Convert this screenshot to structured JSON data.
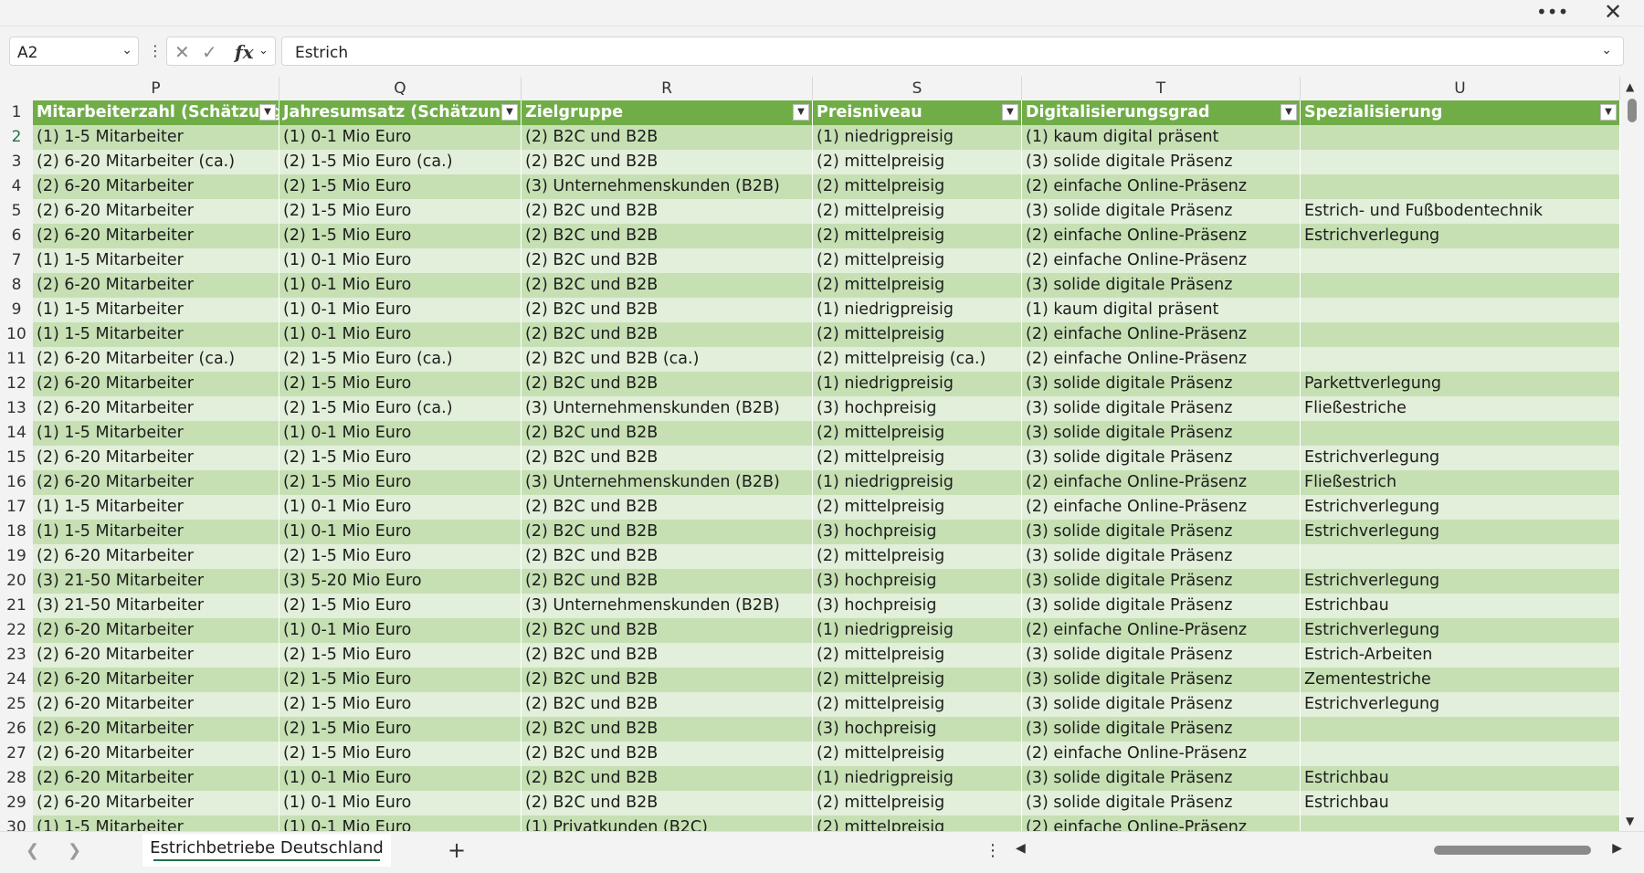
{
  "window": {
    "more_label": "•••",
    "close_label": "✕"
  },
  "formula_bar": {
    "name_box": "A2",
    "cancel_icon": "close-icon",
    "enter_icon": "check-icon",
    "fx_label": "fx",
    "value": "Estrich"
  },
  "columns": [
    "P",
    "Q",
    "R",
    "S",
    "T",
    "U"
  ],
  "row_numbers": [
    "1",
    "2",
    "3",
    "4",
    "5",
    "6",
    "7",
    "8",
    "9",
    "10",
    "11",
    "12",
    "13",
    "14",
    "15",
    "16",
    "17",
    "18",
    "19",
    "20",
    "21",
    "22",
    "23",
    "24",
    "25",
    "26",
    "27",
    "28",
    "29",
    "30"
  ],
  "header": [
    "Mitarbeiterzahl (Schätzung)",
    "Jahresumsatz (Schätzung)",
    "Zielgruppe",
    "Preisniveau",
    "Digitalisierungsgrad",
    "Spezialisierung"
  ],
  "rows": [
    [
      "(1) 1-5 Mitarbeiter",
      "(1) 0-1 Mio Euro",
      "(2) B2C und B2B",
      "(1) niedrigpreisig",
      "(1) kaum digital präsent",
      ""
    ],
    [
      "(2) 6-20 Mitarbeiter (ca.)",
      "(2) 1-5 Mio Euro (ca.)",
      "(2) B2C und B2B",
      "(2) mittelpreisig",
      "(3) solide digitale Präsenz",
      ""
    ],
    [
      "(2) 6-20 Mitarbeiter",
      "(2) 1-5 Mio Euro",
      "(3) Unternehmenskunden (B2B)",
      "(2) mittelpreisig",
      "(2) einfache Online-Präsenz",
      ""
    ],
    [
      "(2) 6-20 Mitarbeiter",
      "(2) 1-5 Mio Euro",
      "(2) B2C und B2B",
      "(2) mittelpreisig",
      "(3) solide digitale Präsenz",
      "Estrich- und Fußbodentechnik"
    ],
    [
      "(2) 6-20 Mitarbeiter",
      "(2) 1-5 Mio Euro",
      "(2) B2C und B2B",
      "(2) mittelpreisig",
      "(2) einfache Online-Präsenz",
      "Estrichverlegung"
    ],
    [
      "(1) 1-5 Mitarbeiter",
      "(1) 0-1 Mio Euro",
      "(2) B2C und B2B",
      "(2) mittelpreisig",
      "(2) einfache Online-Präsenz",
      ""
    ],
    [
      "(2) 6-20 Mitarbeiter",
      "(1) 0-1 Mio Euro",
      "(2) B2C und B2B",
      "(2) mittelpreisig",
      "(3) solide digitale Präsenz",
      ""
    ],
    [
      "(1) 1-5 Mitarbeiter",
      "(1) 0-1 Mio Euro",
      "(2) B2C und B2B",
      "(1) niedrigpreisig",
      "(1) kaum digital präsent",
      ""
    ],
    [
      "(1) 1-5 Mitarbeiter",
      "(1) 0-1 Mio Euro",
      "(2) B2C und B2B",
      "(2) mittelpreisig",
      "(2) einfache Online-Präsenz",
      ""
    ],
    [
      "(2) 6-20 Mitarbeiter (ca.)",
      "(2) 1-5 Mio Euro (ca.)",
      "(2) B2C und B2B (ca.)",
      "(2) mittelpreisig (ca.)",
      "(2) einfache Online-Präsenz",
      ""
    ],
    [
      "(2) 6-20 Mitarbeiter",
      "(2) 1-5 Mio Euro",
      "(2) B2C und B2B",
      "(1) niedrigpreisig",
      "(3) solide digitale Präsenz",
      "Parkettverlegung"
    ],
    [
      "(2) 6-20 Mitarbeiter",
      "(2) 1-5 Mio Euro (ca.)",
      "(3) Unternehmenskunden (B2B)",
      "(3) hochpreisig",
      "(3) solide digitale Präsenz",
      "Fließestriche"
    ],
    [
      "(1) 1-5 Mitarbeiter",
      "(1) 0-1 Mio Euro",
      "(2) B2C und B2B",
      "(2) mittelpreisig",
      "(3) solide digitale Präsenz",
      ""
    ],
    [
      "(2) 6-20 Mitarbeiter",
      "(2) 1-5 Mio Euro",
      "(2) B2C und B2B",
      "(2) mittelpreisig",
      "(3) solide digitale Präsenz",
      "Estrichverlegung"
    ],
    [
      "(2) 6-20 Mitarbeiter",
      "(2) 1-5 Mio Euro",
      "(3) Unternehmenskunden (B2B)",
      "(1) niedrigpreisig",
      "(2) einfache Online-Präsenz",
      "Fließestrich"
    ],
    [
      "(1) 1-5 Mitarbeiter",
      "(1) 0-1 Mio Euro",
      "(2) B2C und B2B",
      "(2) mittelpreisig",
      "(2) einfache Online-Präsenz",
      "Estrichverlegung"
    ],
    [
      "(1) 1-5 Mitarbeiter",
      "(1) 0-1 Mio Euro",
      "(2) B2C und B2B",
      "(3) hochpreisig",
      "(3) solide digitale Präsenz",
      "Estrichverlegung"
    ],
    [
      "(2) 6-20 Mitarbeiter",
      "(2) 1-5 Mio Euro",
      "(2) B2C und B2B",
      "(2) mittelpreisig",
      "(3) solide digitale Präsenz",
      ""
    ],
    [
      "(3) 21-50 Mitarbeiter",
      "(3) 5-20 Mio Euro",
      "(2) B2C und B2B",
      "(3) hochpreisig",
      "(3) solide digitale Präsenz",
      "Estrichverlegung"
    ],
    [
      "(3) 21-50 Mitarbeiter",
      "(2) 1-5 Mio Euro",
      "(3) Unternehmenskunden (B2B)",
      "(3) hochpreisig",
      "(3) solide digitale Präsenz",
      "Estrichbau"
    ],
    [
      "(2) 6-20 Mitarbeiter",
      "(1) 0-1 Mio Euro",
      "(2) B2C und B2B",
      "(1) niedrigpreisig",
      "(2) einfache Online-Präsenz",
      "Estrichverlegung"
    ],
    [
      "(2) 6-20 Mitarbeiter",
      "(2) 1-5 Mio Euro",
      "(2) B2C und B2B",
      "(2) mittelpreisig",
      "(3) solide digitale Präsenz",
      "Estrich-Arbeiten"
    ],
    [
      "(2) 6-20 Mitarbeiter",
      "(2) 1-5 Mio Euro",
      "(2) B2C und B2B",
      "(2) mittelpreisig",
      "(3) solide digitale Präsenz",
      "Zementestriche"
    ],
    [
      "(2) 6-20 Mitarbeiter",
      "(2) 1-5 Mio Euro",
      "(2) B2C und B2B",
      "(2) mittelpreisig",
      "(3) solide digitale Präsenz",
      "Estrichverlegung"
    ],
    [
      "(2) 6-20 Mitarbeiter",
      "(2) 1-5 Mio Euro",
      "(2) B2C und B2B",
      "(3) hochpreisig",
      "(3) solide digitale Präsenz",
      ""
    ],
    [
      "(2) 6-20 Mitarbeiter",
      "(2) 1-5 Mio Euro",
      "(2) B2C und B2B",
      "(2) mittelpreisig",
      "(2) einfache Online-Präsenz",
      ""
    ],
    [
      "(2) 6-20 Mitarbeiter",
      "(1) 0-1 Mio Euro",
      "(2) B2C und B2B",
      "(1) niedrigpreisig",
      "(3) solide digitale Präsenz",
      "Estrichbau"
    ],
    [
      "(2) 6-20 Mitarbeiter",
      "(1) 0-1 Mio Euro",
      "(2) B2C und B2B",
      "(2) mittelpreisig",
      "(3) solide digitale Präsenz",
      "Estrichbau"
    ],
    [
      "(1) 1-5 Mitarbeiter",
      "(1) 0-1 Mio Euro",
      "(1) Privatkunden (B2C)",
      "(2) mittelpreisig",
      "(2) einfache Online-Präsenz",
      ""
    ]
  ],
  "sheet_tabs": {
    "active": "Estrichbetriebe Deutschland",
    "add_label": "+"
  },
  "colors": {
    "header_green": "#70ad47",
    "band_dark": "#c6e0b4",
    "band_light": "#e2efda",
    "accent": "#217346"
  }
}
